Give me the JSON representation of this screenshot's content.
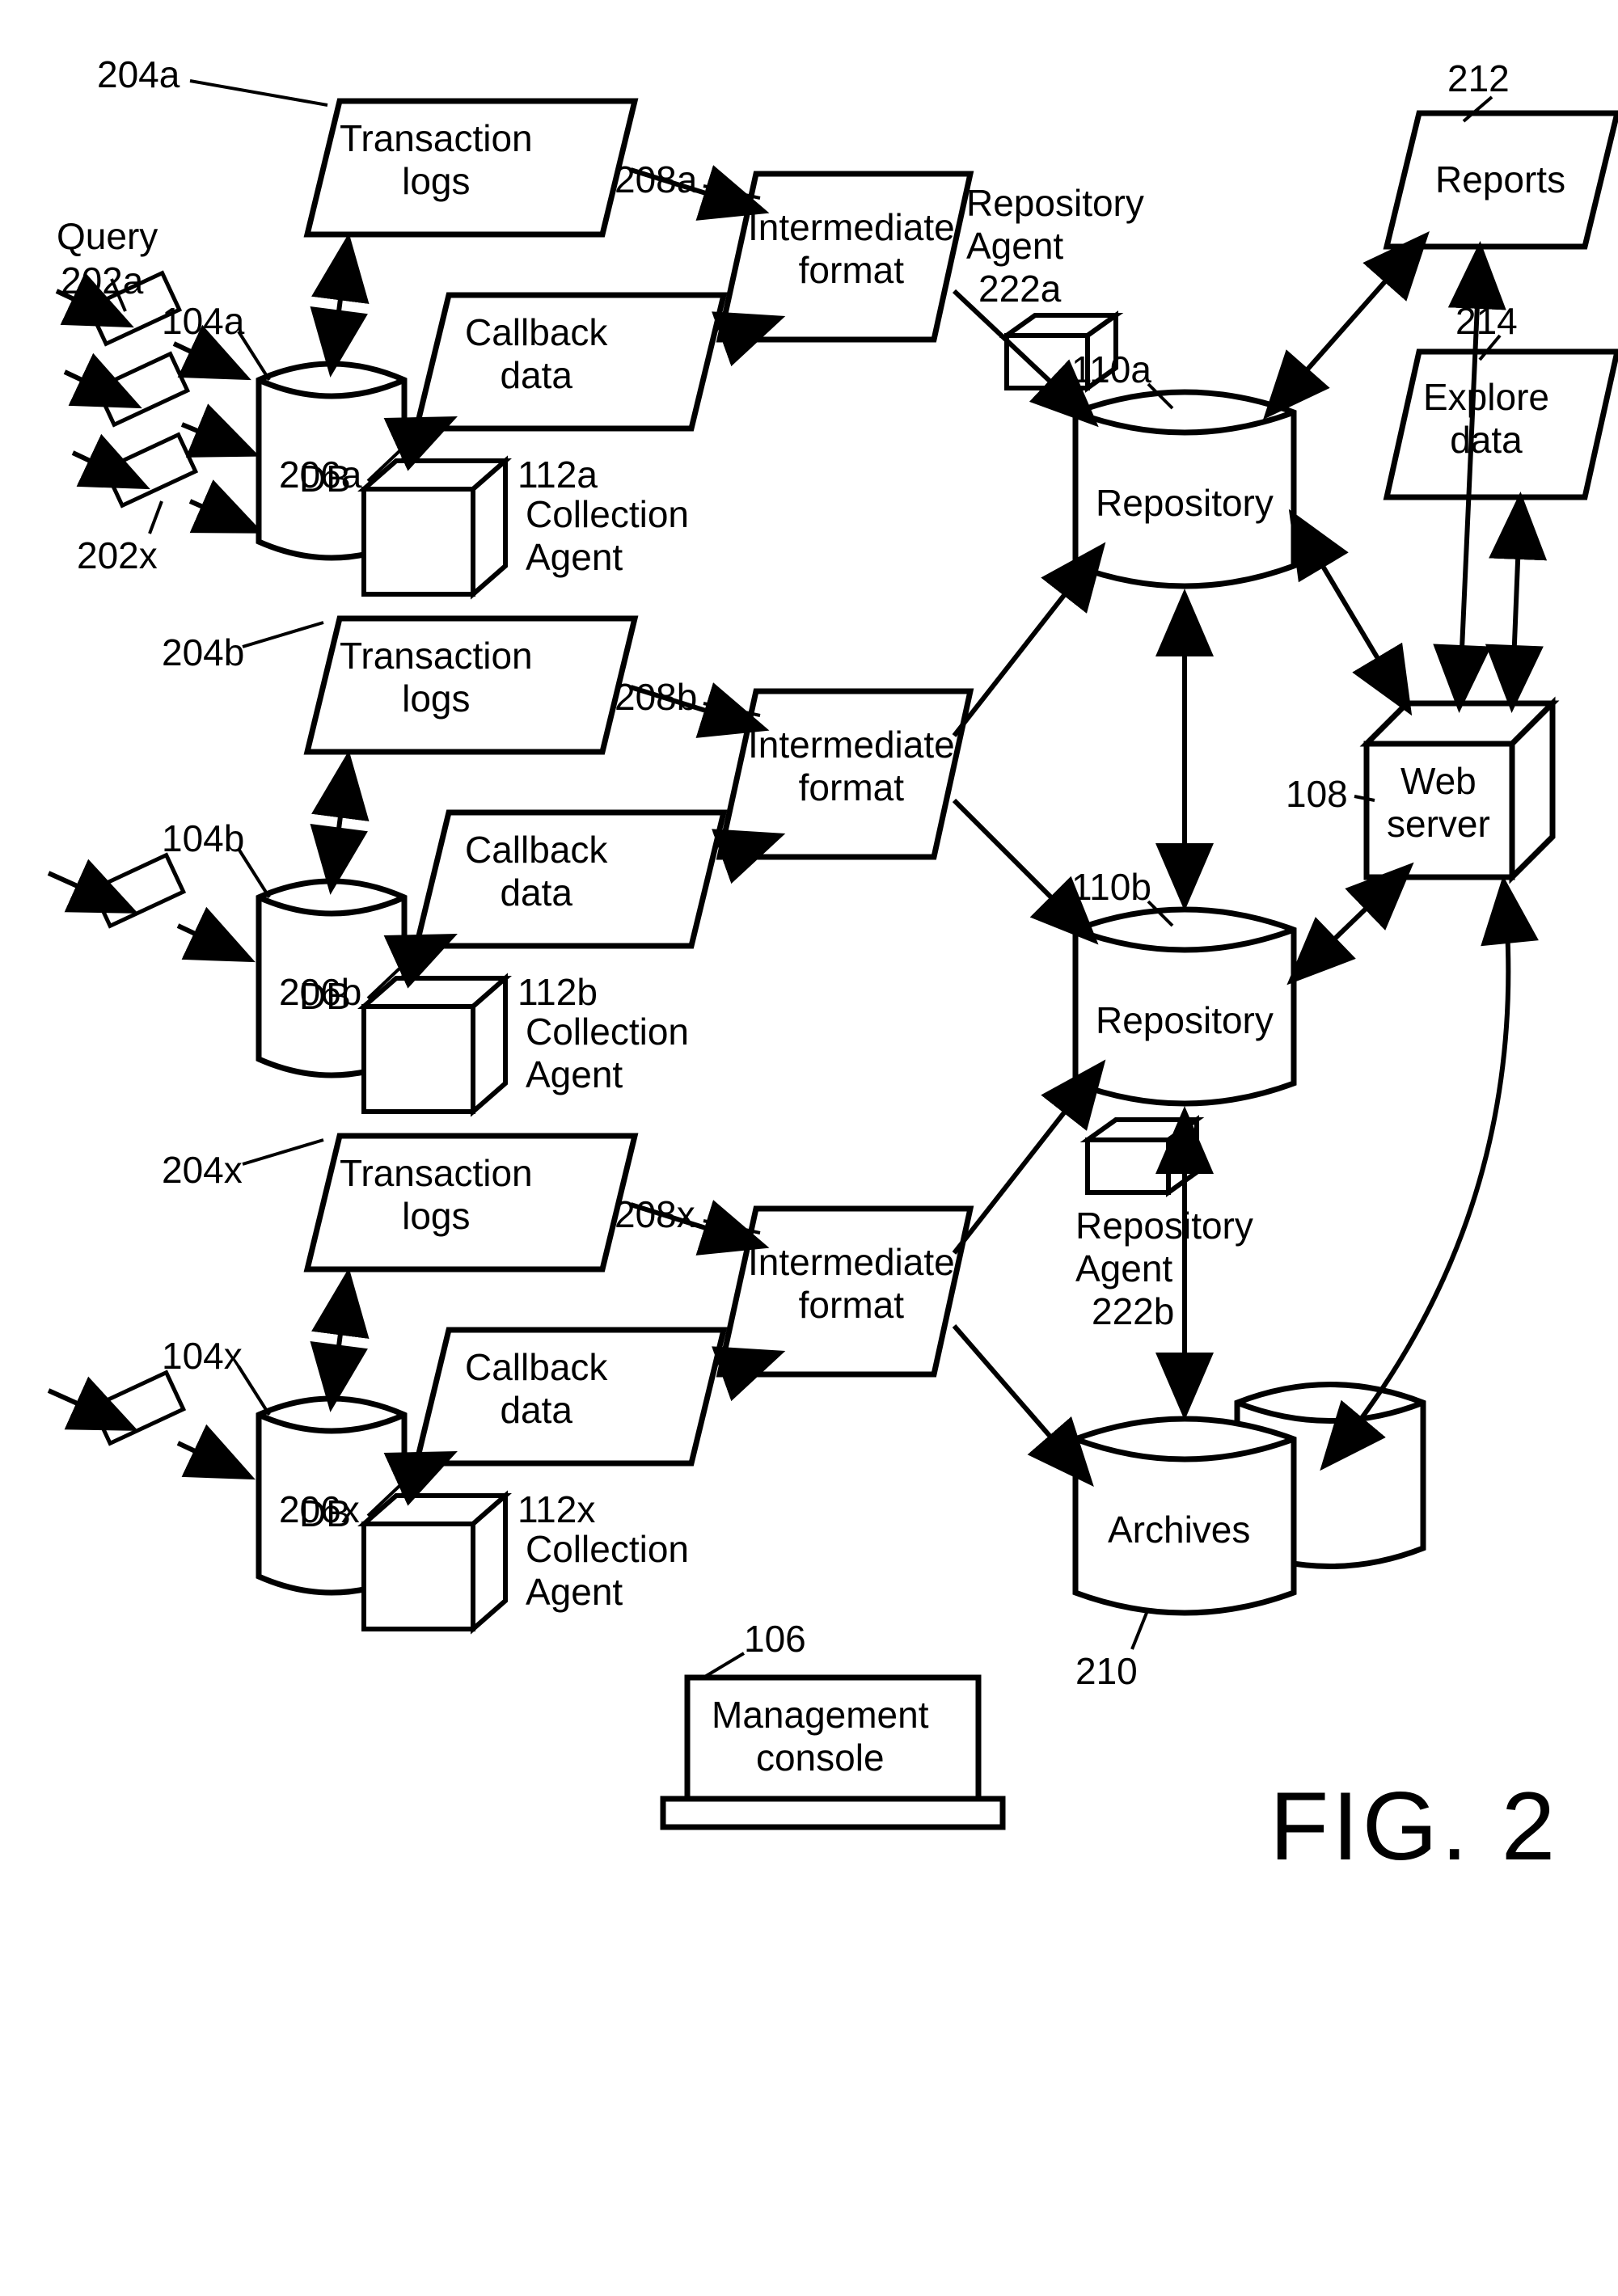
{
  "figure_label": "FIG. 2",
  "db": {
    "query_label": "Query",
    "db_label": "DB"
  },
  "refs": {
    "query_a": "202a",
    "query_x": "202x",
    "db_a": "104a",
    "db_b": "104b",
    "db_x": "104x",
    "tlog_a": "204a",
    "tlog_b": "204b",
    "tlog_x": "204x",
    "cb_a": "206a",
    "cb_b": "206b",
    "cb_x": "206x",
    "ca_a": "112a",
    "ca_b": "112b",
    "ca_x": "112x",
    "if_a": "208a",
    "if_b": "208b",
    "if_x": "208x",
    "repo_a": "110a",
    "repo_b": "110b",
    "ragent_a": "222a",
    "ragent_b": "222b",
    "archives": "210",
    "webserver": "108",
    "reports": "212",
    "explore": "214",
    "console": "106"
  },
  "text": {
    "transaction_logs": "Transaction\nlogs",
    "callback_data": "Callback\ndata",
    "collection_agent": "Collection\nAgent",
    "intermediate_format": "Intermediate\nformat",
    "repository": "Repository",
    "repository_agent": "Repository\nAgent",
    "archives": "Archives",
    "web_server": "Web\nserver",
    "reports": "Reports",
    "explore_data": "Explore\ndata",
    "management_console": "Management\nconsole"
  },
  "chart_data": {
    "type": "diagram",
    "title": "FIG. 2",
    "nodes": [
      {
        "id": "202a",
        "label": "Query",
        "type": "box-small"
      },
      {
        "id": "202x",
        "label": "Query",
        "type": "box-small"
      },
      {
        "id": "104a",
        "label": "DB",
        "type": "cylinder"
      },
      {
        "id": "104b",
        "label": "DB",
        "type": "cylinder"
      },
      {
        "id": "104x",
        "label": "DB",
        "type": "cylinder"
      },
      {
        "id": "204a",
        "label": "Transaction logs",
        "type": "parallelogram"
      },
      {
        "id": "204b",
        "label": "Transaction logs",
        "type": "parallelogram"
      },
      {
        "id": "204x",
        "label": "Transaction logs",
        "type": "parallelogram"
      },
      {
        "id": "206a",
        "label": "Callback data",
        "type": "parallelogram"
      },
      {
        "id": "206b",
        "label": "Callback data",
        "type": "parallelogram"
      },
      {
        "id": "206x",
        "label": "Callback data",
        "type": "parallelogram"
      },
      {
        "id": "112a",
        "label": "Collection Agent",
        "type": "cube"
      },
      {
        "id": "112b",
        "label": "Collection Agent",
        "type": "cube"
      },
      {
        "id": "112x",
        "label": "Collection Agent",
        "type": "cube"
      },
      {
        "id": "208a",
        "label": "Intermediate format",
        "type": "parallelogram"
      },
      {
        "id": "208b",
        "label": "Intermediate format",
        "type": "parallelogram"
      },
      {
        "id": "208x",
        "label": "Intermediate format",
        "type": "parallelogram"
      },
      {
        "id": "110a",
        "label": "Repository",
        "type": "cylinder"
      },
      {
        "id": "110b",
        "label": "Repository",
        "type": "cylinder"
      },
      {
        "id": "222a",
        "label": "Repository Agent",
        "type": "cube"
      },
      {
        "id": "222b",
        "label": "Repository Agent",
        "type": "cube"
      },
      {
        "id": "210",
        "label": "Archives",
        "type": "cylinder"
      },
      {
        "id": "108",
        "label": "Web server",
        "type": "cube"
      },
      {
        "id": "212",
        "label": "Reports",
        "type": "parallelogram"
      },
      {
        "id": "214",
        "label": "Explore data",
        "type": "parallelogram"
      },
      {
        "id": "106",
        "label": "Management console",
        "type": "monitor"
      }
    ],
    "edges": [
      {
        "from": "202a",
        "to": "104a",
        "dir": "single"
      },
      {
        "from": "202x",
        "to": "104a",
        "dir": "single"
      },
      {
        "from": "queries_b",
        "to": "104b",
        "dir": "single"
      },
      {
        "from": "queries_x",
        "to": "104x",
        "dir": "single"
      },
      {
        "from": "104a",
        "to": "204a",
        "dir": "both"
      },
      {
        "from": "104a",
        "to": "206a",
        "dir": "single"
      },
      {
        "from": "204a",
        "to": "208a",
        "dir": "single"
      },
      {
        "from": "206a",
        "to": "208a",
        "dir": "single"
      },
      {
        "from": "104b",
        "to": "204b",
        "dir": "both"
      },
      {
        "from": "104b",
        "to": "206b",
        "dir": "single"
      },
      {
        "from": "204b",
        "to": "208b",
        "dir": "single"
      },
      {
        "from": "206b",
        "to": "208b",
        "dir": "single"
      },
      {
        "from": "104x",
        "to": "204x",
        "dir": "both"
      },
      {
        "from": "104x",
        "to": "206x",
        "dir": "single"
      },
      {
        "from": "204x",
        "to": "208x",
        "dir": "single"
      },
      {
        "from": "206x",
        "to": "208x",
        "dir": "single"
      },
      {
        "from": "208a",
        "to": "110a",
        "dir": "single"
      },
      {
        "from": "208b",
        "to": "110a",
        "dir": "single"
      },
      {
        "from": "208b",
        "to": "110b",
        "dir": "single"
      },
      {
        "from": "208x",
        "to": "110b",
        "dir": "single"
      },
      {
        "from": "208x",
        "to": "210",
        "dir": "single"
      },
      {
        "from": "110a",
        "to": "110b",
        "dir": "both"
      },
      {
        "from": "110b",
        "to": "210",
        "dir": "both"
      },
      {
        "from": "110a",
        "to": "108",
        "dir": "both"
      },
      {
        "from": "110b",
        "to": "108",
        "dir": "both"
      },
      {
        "from": "108",
        "to": "210",
        "dir": "both-curved"
      },
      {
        "from": "108",
        "to": "212",
        "dir": "both"
      },
      {
        "from": "108",
        "to": "214",
        "dir": "both"
      },
      {
        "from": "110a",
        "to": "212",
        "dir": "both"
      }
    ]
  }
}
